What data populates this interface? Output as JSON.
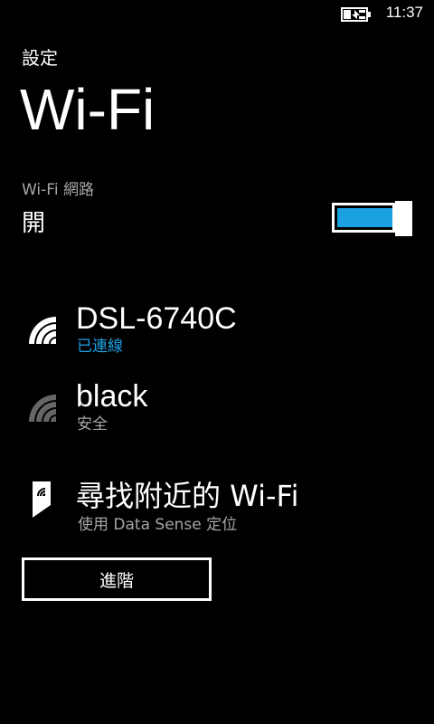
{
  "status_bar": {
    "time": "11:37",
    "battery_icon": "battery-charging-icon"
  },
  "header": {
    "app_title": "設定",
    "page_title": "Wi-Fi"
  },
  "wifi_toggle": {
    "label": "Wi-Fi 網路",
    "state_text": "開",
    "is_on": true,
    "accent_color": "#1ba1e2"
  },
  "networks": [
    {
      "name": "DSL-6740C",
      "status": "已連線",
      "icon": "wifi-signal-icon",
      "connected": true,
      "status_color": "#1ba1e2"
    },
    {
      "name": "black",
      "status": "安全",
      "icon": "wifi-signal-icon",
      "connected": false,
      "status_color": "#a6a6a6"
    }
  ],
  "nearby": {
    "title": "尋找附近的 Wi-Fi",
    "subtitle": "使用 Data Sense 定位",
    "icon": "location-wifi-icon"
  },
  "advanced_button": {
    "label": "進階"
  }
}
